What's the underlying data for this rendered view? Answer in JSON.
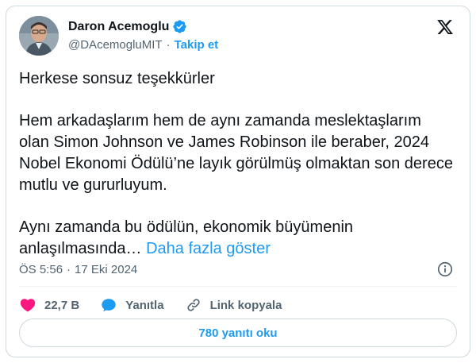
{
  "author": {
    "name": "Daron Acemoglu",
    "handle": "@DAcemogluMIT",
    "follow_label": "Takip et",
    "verified_icon": "verified-badge-icon"
  },
  "tweet": {
    "line1": "Herkese sonsuz teşekkürler",
    "paragraph2": "Hem arkadaşlarım hem de aynı zamanda meslektaşlarım olan Simon Johnson ve James Robinson ile beraber, 2024 Nobel Ekonomi Ödülü’ne layık görülmüş olmaktan son derece mutlu ve gururluyum.",
    "paragraph3": "Aynı zamanda bu ödülün, ekonomik büyümenin anlaşılmasında…",
    "show_more": "Daha fazla göster"
  },
  "meta": {
    "time": "ÖS 5:56",
    "separator": "·",
    "date": "17 Eki 2024"
  },
  "actions": {
    "likes": "22,7 B",
    "reply": "Yanıtla",
    "copy_link": "Link kopyala"
  },
  "replies_button": "780 yanıtı oku",
  "colors": {
    "accent": "#1d9bf0",
    "like": "#f91880",
    "text": "#0f1419",
    "secondary": "#536471",
    "border": "#cfd9de"
  }
}
